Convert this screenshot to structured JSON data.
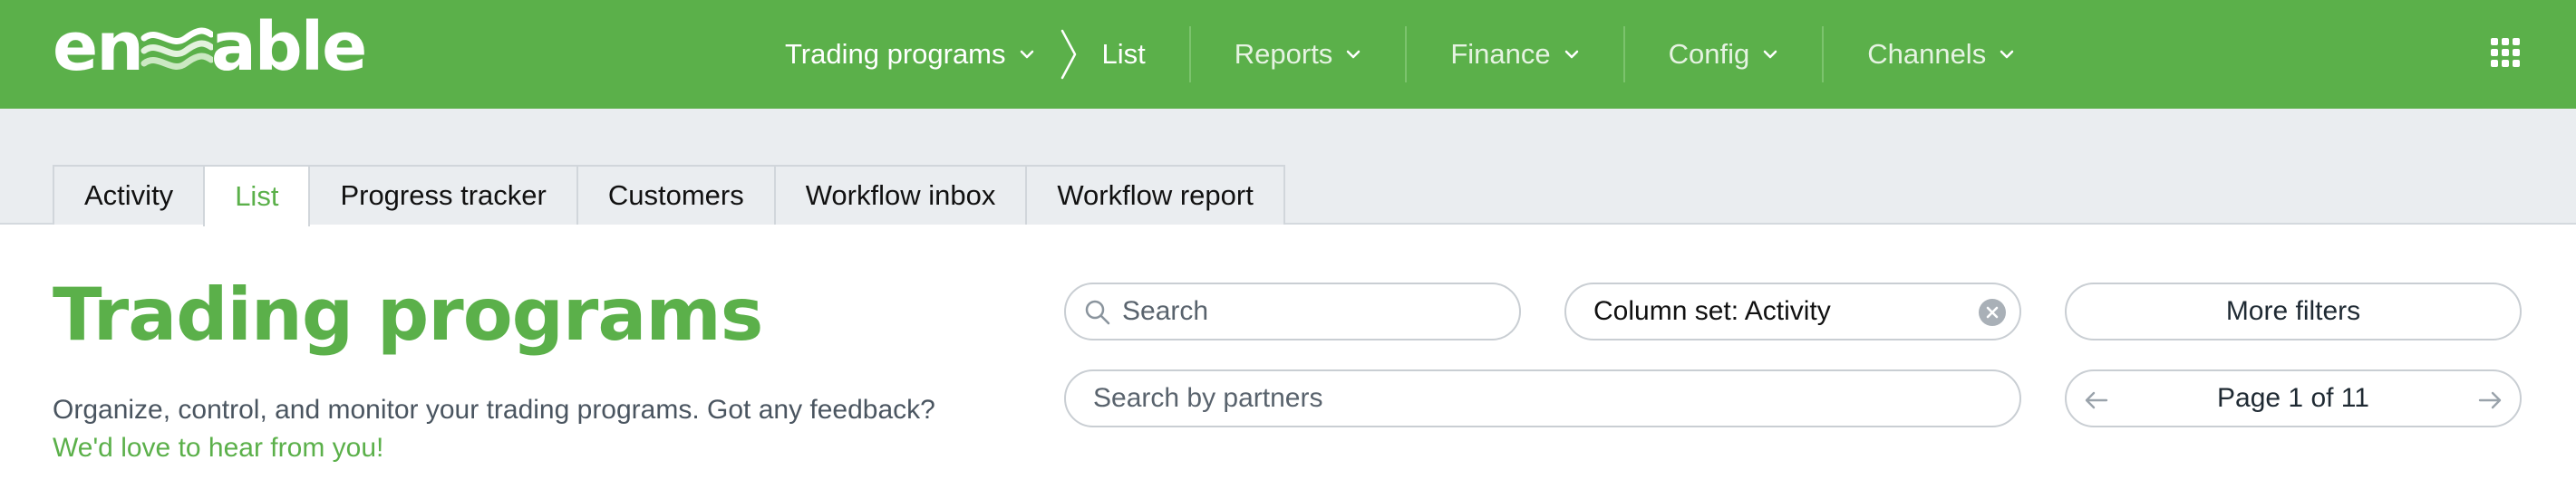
{
  "app": {
    "logo_text_left": "en",
    "logo_text_right": "able",
    "apps_icon": "apps-grid-icon"
  },
  "nav": {
    "breadcrumb_parent": "Trading programs",
    "breadcrumb_current": "List",
    "items": [
      "Reports",
      "Finance",
      "Config",
      "Channels"
    ]
  },
  "tabs": [
    "Activity",
    "List",
    "Progress tracker",
    "Customers",
    "Workflow inbox",
    "Workflow report"
  ],
  "active_tab": "List",
  "page": {
    "title": "Trading programs",
    "description": "Organize, control, and monitor your trading programs. Got any feedback?",
    "feedback_link": "We'd love to hear from you!"
  },
  "filters": {
    "search_placeholder": "Search",
    "column_set": "Column set: Activity",
    "more_filters": "More filters",
    "partners_placeholder": "Search by partners"
  },
  "pager": {
    "label": "Page 1 of 11"
  },
  "colors": {
    "brand_green": "#5bb04a",
    "tab_band": "#eaedf0",
    "border": "#c9ced3"
  }
}
